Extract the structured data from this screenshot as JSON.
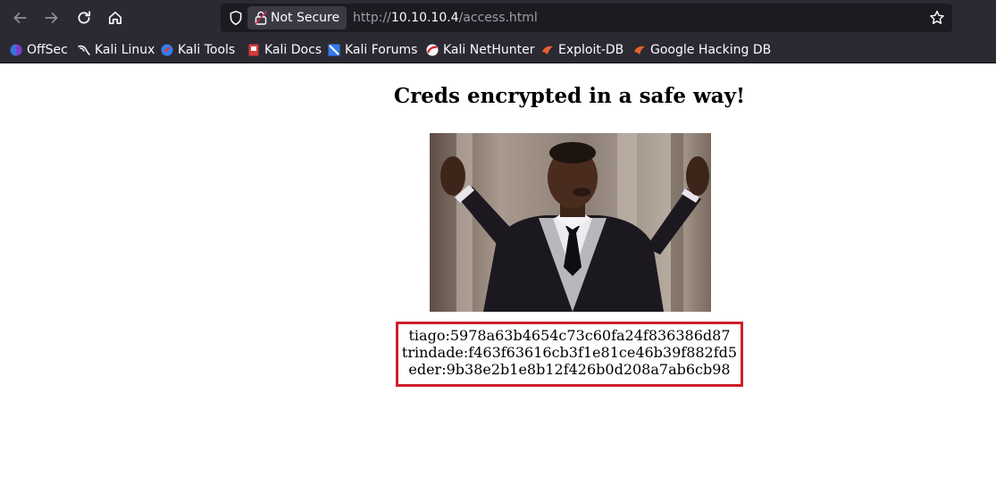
{
  "browser": {
    "security_label": "Not Secure",
    "url": {
      "scheme": "http://",
      "host": "10.10.10.4",
      "path": "/access.html"
    },
    "icons": {
      "back": "arrow-left-icon",
      "forward": "arrow-right-icon",
      "reload": "reload-icon",
      "home": "home-icon",
      "shield": "shield-icon",
      "lock": "insecure-lock-icon",
      "bookmark": "star-icon"
    },
    "colors": {
      "chrome": "#2b2a33",
      "urlbar": "#1c1b22",
      "text": "#fbfbfe"
    }
  },
  "bookmarks": [
    {
      "label": "OffSec",
      "icon": "offsec-icon"
    },
    {
      "label": "Kali Linux",
      "icon": "kali-dragon-icon"
    },
    {
      "label": "Kali Tools",
      "icon": "kali-tools-icon"
    },
    {
      "label": "Kali Docs",
      "icon": "kali-docs-icon"
    },
    {
      "label": "Kali Forums",
      "icon": "kali-forums-icon"
    },
    {
      "label": "Kali NetHunter",
      "icon": "kali-nethunter-icon"
    },
    {
      "label": "Exploit-DB",
      "icon": "exploit-db-icon"
    },
    {
      "label": "Google Hacking DB",
      "icon": "ghdb-icon"
    }
  ],
  "page": {
    "title": "Creds encrypted in a safe way!",
    "image": "photo-of-man-in-tuxedo-with-raised-hands",
    "credentials": [
      "tiago:5978a63b4654c73c60fa24f836386d87",
      "trindade:f463f63616cb3f1e81ce46b39f882fd5",
      "eder:9b38e2b1e8b12f426b0d208a7ab6cb98"
    ],
    "box_color": "#d01f2a"
  }
}
